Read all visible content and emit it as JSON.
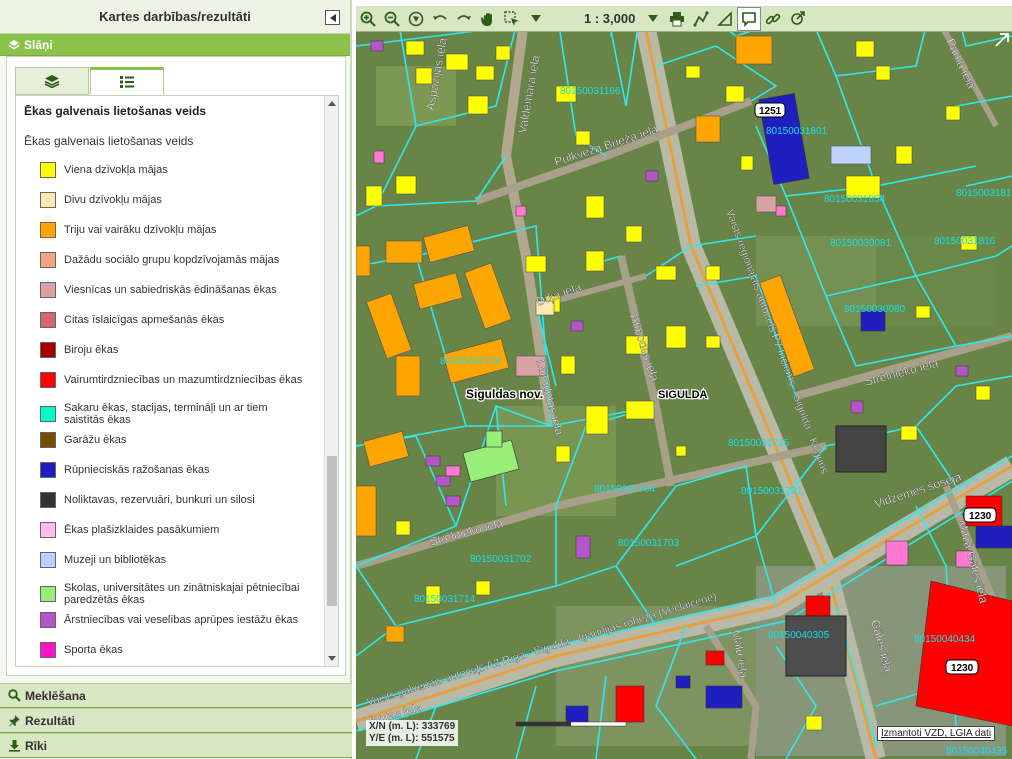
{
  "panel": {
    "title": "Kartes darbības/rezultāti",
    "layers_label": "Slāņi",
    "search_label": "Meklēšana",
    "results_label": "Rezultāti",
    "tools_label": "Rīki"
  },
  "legend": {
    "title": "Ēkas galvenais lietošanas veids",
    "subtitle": "Ēkas galvenais lietošanas veids",
    "items": [
      {
        "label": "Viena dzīvokļa mājas",
        "color": "#ffff00"
      },
      {
        "label": "Divu dzīvokļu mājas",
        "color": "#ffe9b0"
      },
      {
        "label": "Triju vai vairāku dzīvokļu mājas",
        "color": "#ffa500"
      },
      {
        "label": "Dažādu sociālo grupu kopdzīvojamās mājas",
        "color": "#f7a383"
      },
      {
        "label": "Viesnīcas un sabiedriskās ēdināšanas ēkas",
        "color": "#d9a3a3"
      },
      {
        "label": "Citas īslaicīgas apmešanās ēkas",
        "color": "#d26a6a"
      },
      {
        "label": "Biroju ēkas",
        "color": "#a80000"
      },
      {
        "label": "Vairumtirdzniecības un mazumtirdzniecības ēkas",
        "color": "#ff0000"
      },
      {
        "label": "Sakaru ēkas, stacijas, termināļi un ar tiem saistītās ēkas",
        "color": "#00ffc5"
      },
      {
        "label": "Garāžu ēkas",
        "color": "#734c00"
      },
      {
        "label": "Rūpnieciskās ražošanas ēkas",
        "color": "#1f1fbf"
      },
      {
        "label": "Noliktavas, rezervuāri, bunkuri un silosi",
        "color": "#333333"
      },
      {
        "label": "Ēkas plašizklaides pasākumiem",
        "color": "#ffbee8"
      },
      {
        "label": "Muzeji un bibliotēkas",
        "color": "#bed2ff"
      },
      {
        "label": "Skolas, universitātes un zinātniskajai pētniecībai paredzētās ēkas",
        "color": "#98f07a"
      },
      {
        "label": "Ārstniecības vai veselības aprūpes iestāžu ēkas",
        "color": "#b456c8"
      },
      {
        "label": "Sporta ēkas",
        "color": "#ff14c8"
      }
    ]
  },
  "toolbar": {
    "scale": "1 : 3,000"
  },
  "map": {
    "streets": [
      "Aspazijas iela",
      "Valdemāra iela",
      "Pulkveža Brieža iela",
      "Dīķa iela",
      "Atmodas iela",
      "Laimdotas iela",
      "Strēlnieku iela",
      "Vidzemes šoseja",
      "Mazā Gāles iela",
      "Gāles iela",
      "Mālu iela",
      "Ventas iela",
      "Parka iela",
      "Vaists galvenais autoceļš A2 Rīga - Sigulda - Igaunijas robeža (Veclaicene)",
      "Vaists reģionālais autoceļš P7 Inciems - Sigulda - Ķeguns"
    ],
    "places": [
      "Siguldas nov.",
      "SIGULDA"
    ],
    "parcels": [
      "80150031166",
      "80150031801",
      "80150031854",
      "80150031815",
      "80150031816",
      "80150030081",
      "80150030080",
      "80150031725",
      "80150031731",
      "80150031704",
      "80150031703",
      "80150031702",
      "80150031714",
      "80150040305",
      "80150040434",
      "80150040435",
      "80150031744"
    ],
    "labels": [
      "1251",
      "1230",
      "1230"
    ],
    "xn_label": "X/N (m. L):",
    "xn_value": "333769",
    "ye_label": "Y/E (m. L):",
    "ye_value": "551575",
    "attribution": "Izmantoti VZD, LGIA dati"
  }
}
